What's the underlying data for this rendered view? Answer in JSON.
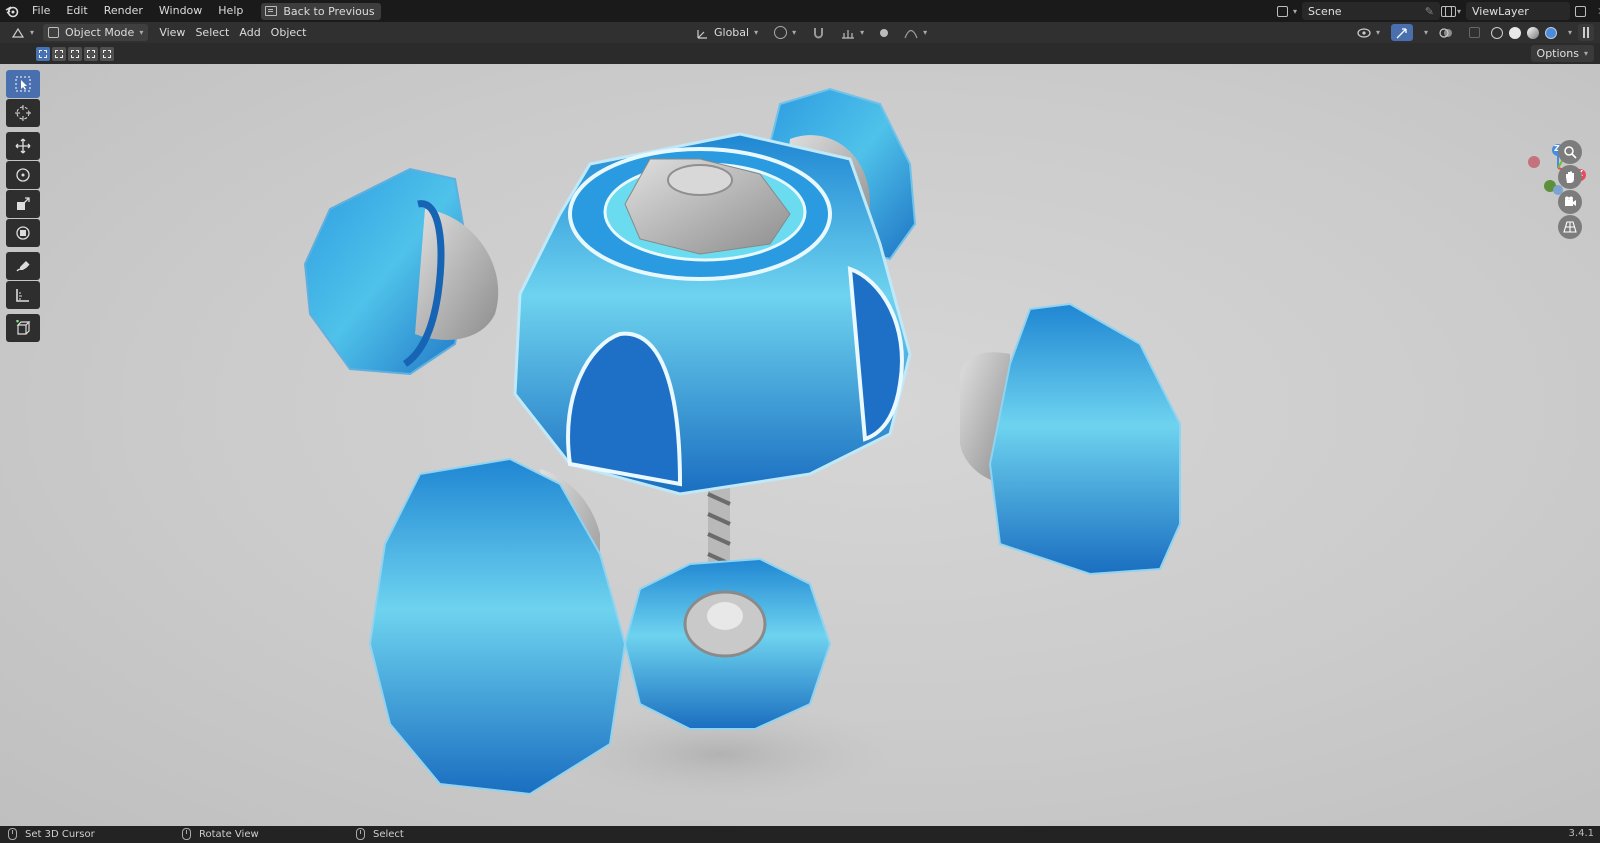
{
  "menu": {
    "items": [
      "File",
      "Edit",
      "Render",
      "Window",
      "Help"
    ],
    "back_button": "Back to Previous"
  },
  "scene": {
    "name": "Scene",
    "view_layer": "ViewLayer"
  },
  "header": {
    "mode": "Object Mode",
    "menus": [
      "View",
      "Select",
      "Add",
      "Object"
    ],
    "transform_orientation": "Global"
  },
  "tool_settings": {
    "options": "Options"
  },
  "viewport": {
    "gizmo_axes": {
      "x": "X",
      "y": "Y",
      "z": "Z"
    },
    "colors": {
      "x": "#e94b5b",
      "y": "#7bb935",
      "z": "#4a8bdb",
      "selected": "#4a6fae"
    }
  },
  "statusbar": {
    "items": [
      "Set 3D Cursor",
      "Rotate View",
      "Select"
    ],
    "version": "3.4.1"
  }
}
